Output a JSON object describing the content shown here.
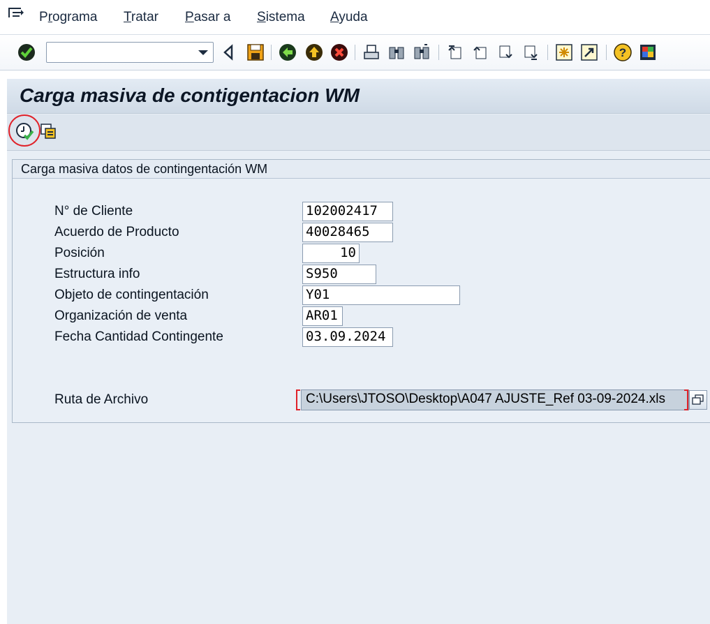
{
  "menu": {
    "items": [
      "Programa",
      "Tratar",
      "Pasar a",
      "Sistema",
      "Ayuda"
    ],
    "underline": [
      "r",
      "T",
      "P",
      "S",
      "A"
    ]
  },
  "toolbar": {
    "command_field_value": "",
    "icons": [
      "enter-check",
      "back",
      "save",
      "back-green",
      "exit-yellow",
      "cancel-red",
      "print",
      "find",
      "find-next",
      "first-page",
      "previous-page",
      "next-page",
      "last-page",
      "create-session",
      "create-shortcut",
      "help",
      "customize-layout"
    ]
  },
  "screen": {
    "title": "Carga masiva de contigentacion WM"
  },
  "app_toolbar": {
    "icons": [
      "execute-icon",
      "multiple-selection-icon"
    ]
  },
  "group": {
    "title": "Carga masiva datos de contingentación WM",
    "fields": [
      {
        "label": "N° de Cliente",
        "value": "102002417"
      },
      {
        "label": "Acuerdo de Producto",
        "value": "40028465"
      },
      {
        "label": "Posición",
        "value": "10"
      },
      {
        "label": "Estructura info",
        "value": "S950"
      },
      {
        "label": "Objeto de contingentación",
        "value": "Y01"
      },
      {
        "label": "Organización de venta",
        "value": "AR01"
      },
      {
        "label": "Fecha Cantidad Contingente",
        "value": "03.09.2024"
      }
    ],
    "file": {
      "label": "Ruta de Archivo",
      "value": "C:\\Users\\JTOSO\\Desktop\\A047 AJUSTE_Ref 03-09-2024.xls"
    }
  },
  "colors": {
    "highlight": "#e0222a",
    "title_text": "#0b1524",
    "background": "#e8eef5"
  }
}
